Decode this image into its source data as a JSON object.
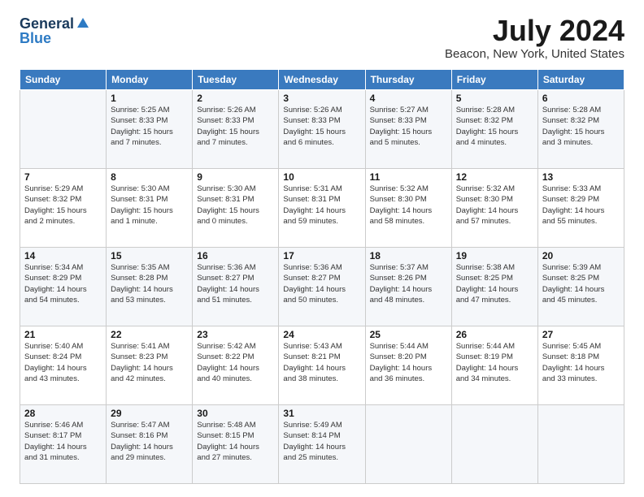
{
  "logo": {
    "general": "General",
    "blue": "Blue"
  },
  "header": {
    "month": "July 2024",
    "location": "Beacon, New York, United States"
  },
  "weekdays": [
    "Sunday",
    "Monday",
    "Tuesday",
    "Wednesday",
    "Thursday",
    "Friday",
    "Saturday"
  ],
  "weeks": [
    [
      {
        "date": "",
        "info": ""
      },
      {
        "date": "1",
        "info": "Sunrise: 5:25 AM\nSunset: 8:33 PM\nDaylight: 15 hours\nand 7 minutes."
      },
      {
        "date": "2",
        "info": "Sunrise: 5:26 AM\nSunset: 8:33 PM\nDaylight: 15 hours\nand 7 minutes."
      },
      {
        "date": "3",
        "info": "Sunrise: 5:26 AM\nSunset: 8:33 PM\nDaylight: 15 hours\nand 6 minutes."
      },
      {
        "date": "4",
        "info": "Sunrise: 5:27 AM\nSunset: 8:33 PM\nDaylight: 15 hours\nand 5 minutes."
      },
      {
        "date": "5",
        "info": "Sunrise: 5:28 AM\nSunset: 8:32 PM\nDaylight: 15 hours\nand 4 minutes."
      },
      {
        "date": "6",
        "info": "Sunrise: 5:28 AM\nSunset: 8:32 PM\nDaylight: 15 hours\nand 3 minutes."
      }
    ],
    [
      {
        "date": "7",
        "info": "Sunrise: 5:29 AM\nSunset: 8:32 PM\nDaylight: 15 hours\nand 2 minutes."
      },
      {
        "date": "8",
        "info": "Sunrise: 5:30 AM\nSunset: 8:31 PM\nDaylight: 15 hours\nand 1 minute."
      },
      {
        "date": "9",
        "info": "Sunrise: 5:30 AM\nSunset: 8:31 PM\nDaylight: 15 hours\nand 0 minutes."
      },
      {
        "date": "10",
        "info": "Sunrise: 5:31 AM\nSunset: 8:31 PM\nDaylight: 14 hours\nand 59 minutes."
      },
      {
        "date": "11",
        "info": "Sunrise: 5:32 AM\nSunset: 8:30 PM\nDaylight: 14 hours\nand 58 minutes."
      },
      {
        "date": "12",
        "info": "Sunrise: 5:32 AM\nSunset: 8:30 PM\nDaylight: 14 hours\nand 57 minutes."
      },
      {
        "date": "13",
        "info": "Sunrise: 5:33 AM\nSunset: 8:29 PM\nDaylight: 14 hours\nand 55 minutes."
      }
    ],
    [
      {
        "date": "14",
        "info": "Sunrise: 5:34 AM\nSunset: 8:29 PM\nDaylight: 14 hours\nand 54 minutes."
      },
      {
        "date": "15",
        "info": "Sunrise: 5:35 AM\nSunset: 8:28 PM\nDaylight: 14 hours\nand 53 minutes."
      },
      {
        "date": "16",
        "info": "Sunrise: 5:36 AM\nSunset: 8:27 PM\nDaylight: 14 hours\nand 51 minutes."
      },
      {
        "date": "17",
        "info": "Sunrise: 5:36 AM\nSunset: 8:27 PM\nDaylight: 14 hours\nand 50 minutes."
      },
      {
        "date": "18",
        "info": "Sunrise: 5:37 AM\nSunset: 8:26 PM\nDaylight: 14 hours\nand 48 minutes."
      },
      {
        "date": "19",
        "info": "Sunrise: 5:38 AM\nSunset: 8:25 PM\nDaylight: 14 hours\nand 47 minutes."
      },
      {
        "date": "20",
        "info": "Sunrise: 5:39 AM\nSunset: 8:25 PM\nDaylight: 14 hours\nand 45 minutes."
      }
    ],
    [
      {
        "date": "21",
        "info": "Sunrise: 5:40 AM\nSunset: 8:24 PM\nDaylight: 14 hours\nand 43 minutes."
      },
      {
        "date": "22",
        "info": "Sunrise: 5:41 AM\nSunset: 8:23 PM\nDaylight: 14 hours\nand 42 minutes."
      },
      {
        "date": "23",
        "info": "Sunrise: 5:42 AM\nSunset: 8:22 PM\nDaylight: 14 hours\nand 40 minutes."
      },
      {
        "date": "24",
        "info": "Sunrise: 5:43 AM\nSunset: 8:21 PM\nDaylight: 14 hours\nand 38 minutes."
      },
      {
        "date": "25",
        "info": "Sunrise: 5:44 AM\nSunset: 8:20 PM\nDaylight: 14 hours\nand 36 minutes."
      },
      {
        "date": "26",
        "info": "Sunrise: 5:44 AM\nSunset: 8:19 PM\nDaylight: 14 hours\nand 34 minutes."
      },
      {
        "date": "27",
        "info": "Sunrise: 5:45 AM\nSunset: 8:18 PM\nDaylight: 14 hours\nand 33 minutes."
      }
    ],
    [
      {
        "date": "28",
        "info": "Sunrise: 5:46 AM\nSunset: 8:17 PM\nDaylight: 14 hours\nand 31 minutes."
      },
      {
        "date": "29",
        "info": "Sunrise: 5:47 AM\nSunset: 8:16 PM\nDaylight: 14 hours\nand 29 minutes."
      },
      {
        "date": "30",
        "info": "Sunrise: 5:48 AM\nSunset: 8:15 PM\nDaylight: 14 hours\nand 27 minutes."
      },
      {
        "date": "31",
        "info": "Sunrise: 5:49 AM\nSunset: 8:14 PM\nDaylight: 14 hours\nand 25 minutes."
      },
      {
        "date": "",
        "info": ""
      },
      {
        "date": "",
        "info": ""
      },
      {
        "date": "",
        "info": ""
      }
    ]
  ]
}
